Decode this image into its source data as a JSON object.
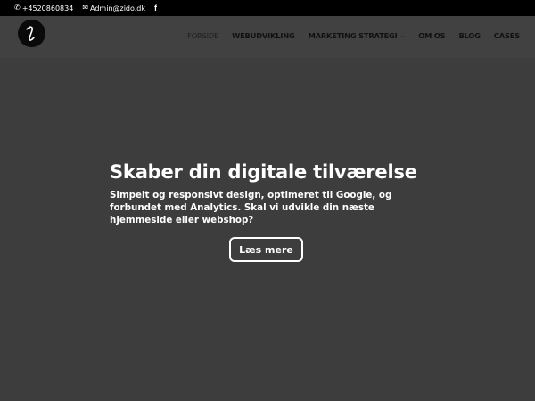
{
  "topbar": {
    "phone": "+4520860834",
    "phone_icon": "phone-icon",
    "email": "Admin@zido.dk",
    "email_icon": "envelope-icon",
    "social_icon": "facebook-icon",
    "social_glyph": "f"
  },
  "header": {
    "logo_icon": "logo-icon",
    "nav": [
      {
        "label": "FORSIDE",
        "active": true
      },
      {
        "label": "WEBUDVIKLING"
      },
      {
        "label": "MARKETING STRATEGI",
        "has_dropdown": true
      },
      {
        "label": "OM OS"
      },
      {
        "label": "BLOG"
      },
      {
        "label": "CASES"
      }
    ]
  },
  "hero": {
    "title": "Skaber din digitale tilværelse",
    "subtitle": "Simpelt og responsivt design, optimeret til Google, og forbundet med Analytics. Skal vi udvikle din næste hjemmeside eller webshop?",
    "button_label": "Læs mere"
  },
  "colors": {
    "topbar_bg": "#000000",
    "header_bg": "#414141",
    "hero_bg": "#3d3d3d",
    "text_light": "#ffffff",
    "nav_text": "#111111"
  }
}
